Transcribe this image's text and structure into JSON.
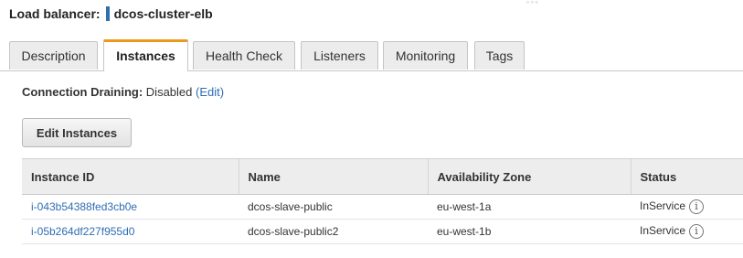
{
  "header": {
    "label": "Load balancer:",
    "name": "dcos-cluster-elb"
  },
  "tabs": [
    {
      "label": "Description",
      "active": false
    },
    {
      "label": "Instances",
      "active": true
    },
    {
      "label": "Health Check",
      "active": false
    },
    {
      "label": "Listeners",
      "active": false
    },
    {
      "label": "Monitoring",
      "active": false
    },
    {
      "label": "Tags",
      "active": false
    }
  ],
  "connection_draining": {
    "label": "Connection Draining:",
    "value": "Disabled",
    "edit_link": "(Edit)"
  },
  "edit_instances_button": "Edit Instances",
  "table": {
    "columns": [
      "Instance ID",
      "Name",
      "Availability Zone",
      "Status"
    ],
    "rows": [
      {
        "instance_id": "i-043b54388fed3cb0e",
        "name": "dcos-slave-public",
        "zone": "eu-west-1a",
        "status": "InService"
      },
      {
        "instance_id": "i-05b264df227f955d0",
        "name": "dcos-slave-public2",
        "zone": "eu-west-1b",
        "status": "InService"
      }
    ]
  },
  "icons": {
    "status_info": "info-icon",
    "name_marker": "color-marker"
  },
  "colors": {
    "active_tab_accent": "#ec9a1e",
    "link": "#2e6eb3",
    "name_marker": "#2f6fb0"
  }
}
